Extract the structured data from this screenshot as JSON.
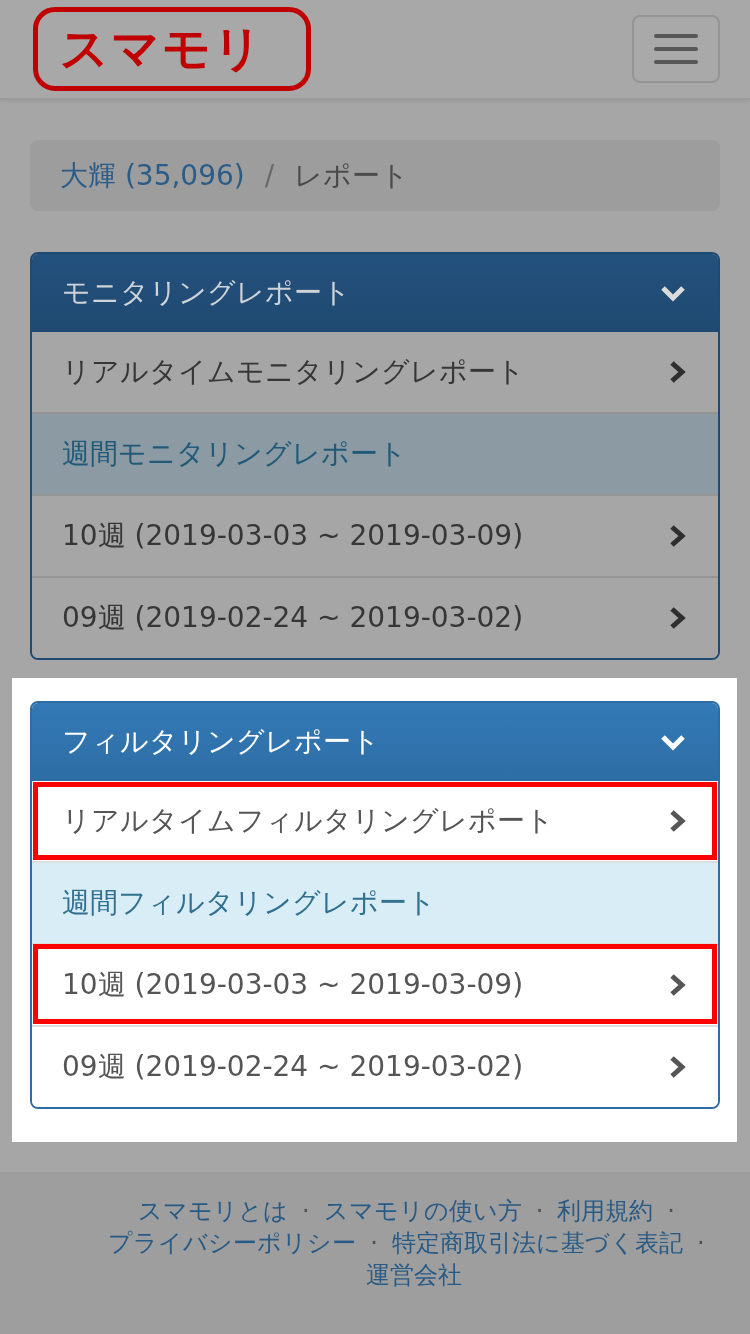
{
  "header": {
    "logo": "スマモリ"
  },
  "breadcrumb": {
    "separator": "/",
    "items": [
      {
        "label": "大輝 (35,096)",
        "kind": "link"
      },
      {
        "label": "レポート",
        "kind": "current"
      }
    ]
  },
  "panels": [
    {
      "title": "モニタリングレポート",
      "expanded": true,
      "spotlight": false,
      "items": [
        {
          "kind": "link",
          "label": "リアルタイムモニタリングレポート",
          "annotated": false
        },
        {
          "kind": "subheading",
          "label": "週間モニタリングレポート",
          "annotated": false
        },
        {
          "kind": "link",
          "label": "10週 (2019-03-03 ~ 2019-03-09)",
          "annotated": false
        },
        {
          "kind": "link",
          "label": "09週 (2019-02-24 ~ 2019-03-02)",
          "annotated": false
        }
      ]
    },
    {
      "title": "フィルタリングレポート",
      "expanded": true,
      "spotlight": true,
      "items": [
        {
          "kind": "link",
          "label": "リアルタイムフィルタリングレポート",
          "annotated": true
        },
        {
          "kind": "subheading",
          "label": "週間フィルタリングレポート",
          "annotated": false
        },
        {
          "kind": "link",
          "label": "10週 (2019-03-03 ~ 2019-03-09)",
          "annotated": true
        },
        {
          "kind": "link",
          "label": "09週 (2019-02-24 ~ 2019-03-02)",
          "annotated": false
        }
      ]
    }
  ],
  "footer": {
    "separator": "·",
    "links": [
      "スマモリとは",
      "スマモリの使い方",
      "利用規約",
      "プライバシーポリシー",
      "特定商取引法に基づく表記",
      "運営会社"
    ]
  }
}
